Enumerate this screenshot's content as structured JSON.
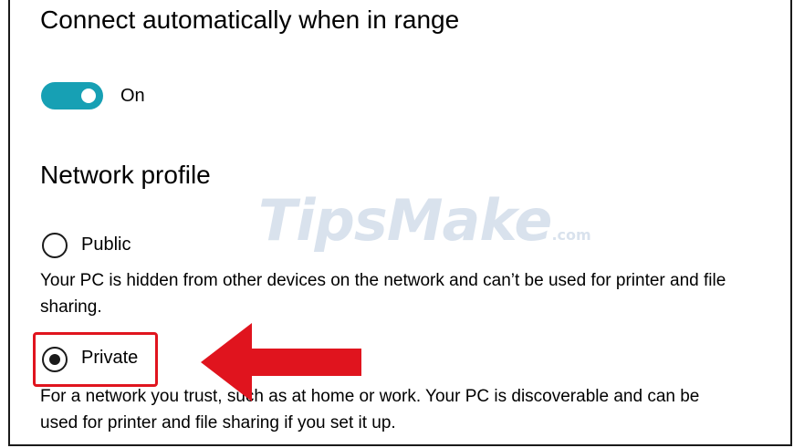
{
  "connect": {
    "heading": "Connect automatically when in range",
    "toggle_state_label": "On",
    "toggle_on": true,
    "toggle_color": "#17a0b4"
  },
  "network_profile": {
    "heading": "Network profile",
    "options": [
      {
        "label": "Public",
        "selected": false,
        "description": "Your PC is hidden from other devices on the network and can’t be used for printer and file sharing."
      },
      {
        "label": "Private",
        "selected": true,
        "description": "For a network you trust, such as at home or work. Your PC is discoverable and can be used for printer and file sharing if you set it up."
      }
    ]
  },
  "annotation": {
    "highlight_color": "#e0141e",
    "highlighted_option": "Private"
  },
  "watermark": {
    "brand": "TipsMake",
    "suffix": ".com"
  }
}
